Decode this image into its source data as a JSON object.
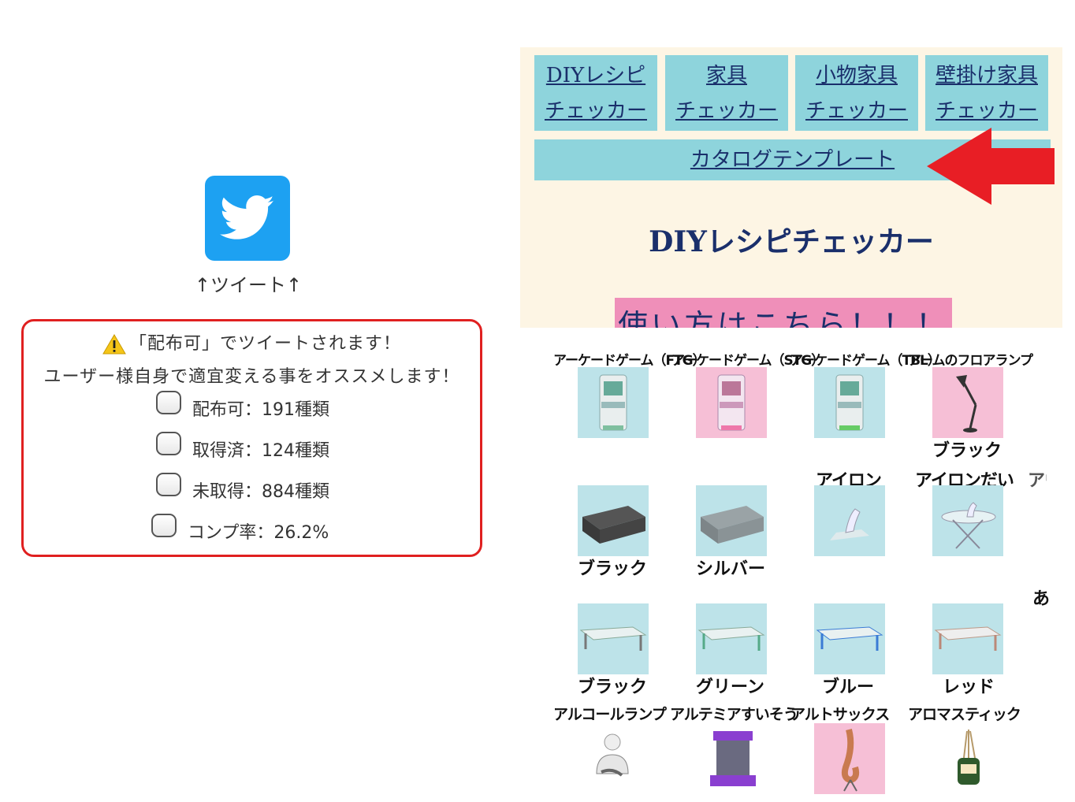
{
  "tweet": {
    "caption": "↑ツイート↑"
  },
  "notice": {
    "line1": "「配布可」でツイートされます！",
    "line2": "ユーザー様自身で適宜変える事をオススメします！",
    "stats": [
      {
        "label": "配布可：191種類"
      },
      {
        "label": "取得済：124種類"
      },
      {
        "label": "未取得：884種類"
      },
      {
        "label": "コンプ率：26.2%"
      }
    ]
  },
  "nav": {
    "tiles": [
      {
        "line1": "DIYレシピ",
        "line2": "チェッカー"
      },
      {
        "line1": "家具",
        "line2": "チェッカー"
      },
      {
        "line1": "小物家具",
        "line2": "チェッカー"
      },
      {
        "line1": "壁掛け家具",
        "line2": "チェッカー"
      }
    ],
    "catalog": "カタログテンプレート"
  },
  "site": {
    "title": "DIYレシピチェッカー",
    "howto": "使い方はこちら！！！"
  },
  "catalog": {
    "headers_row1": [
      "アーケードゲーム（FTG）",
      "アーケードゲーム（STG）",
      "アーケードゲーム（TBL）",
      "アームのフロアランプ"
    ],
    "row1_variants": [
      "",
      "",
      "",
      "ブラック"
    ],
    "headers_row2": [
      "",
      "",
      "アイロン",
      "アイロンだい"
    ],
    "header_cut": "アウ",
    "row2_variants": [
      "ブラック",
      "シルバー",
      "",
      ""
    ],
    "side_char": "あ",
    "row3_variants": [
      "ブラック",
      "グリーン",
      "ブルー",
      "レッド"
    ],
    "headers_row4": [
      "アルコールランプ",
      "アルテミアすいそう",
      "アルトサックス",
      "アロマスティック"
    ]
  },
  "colors": {
    "accent_blue": "#8ed4dc",
    "nav_text": "#1a2f6b",
    "alert_red": "#e02020",
    "twitter": "#1da1f2"
  }
}
